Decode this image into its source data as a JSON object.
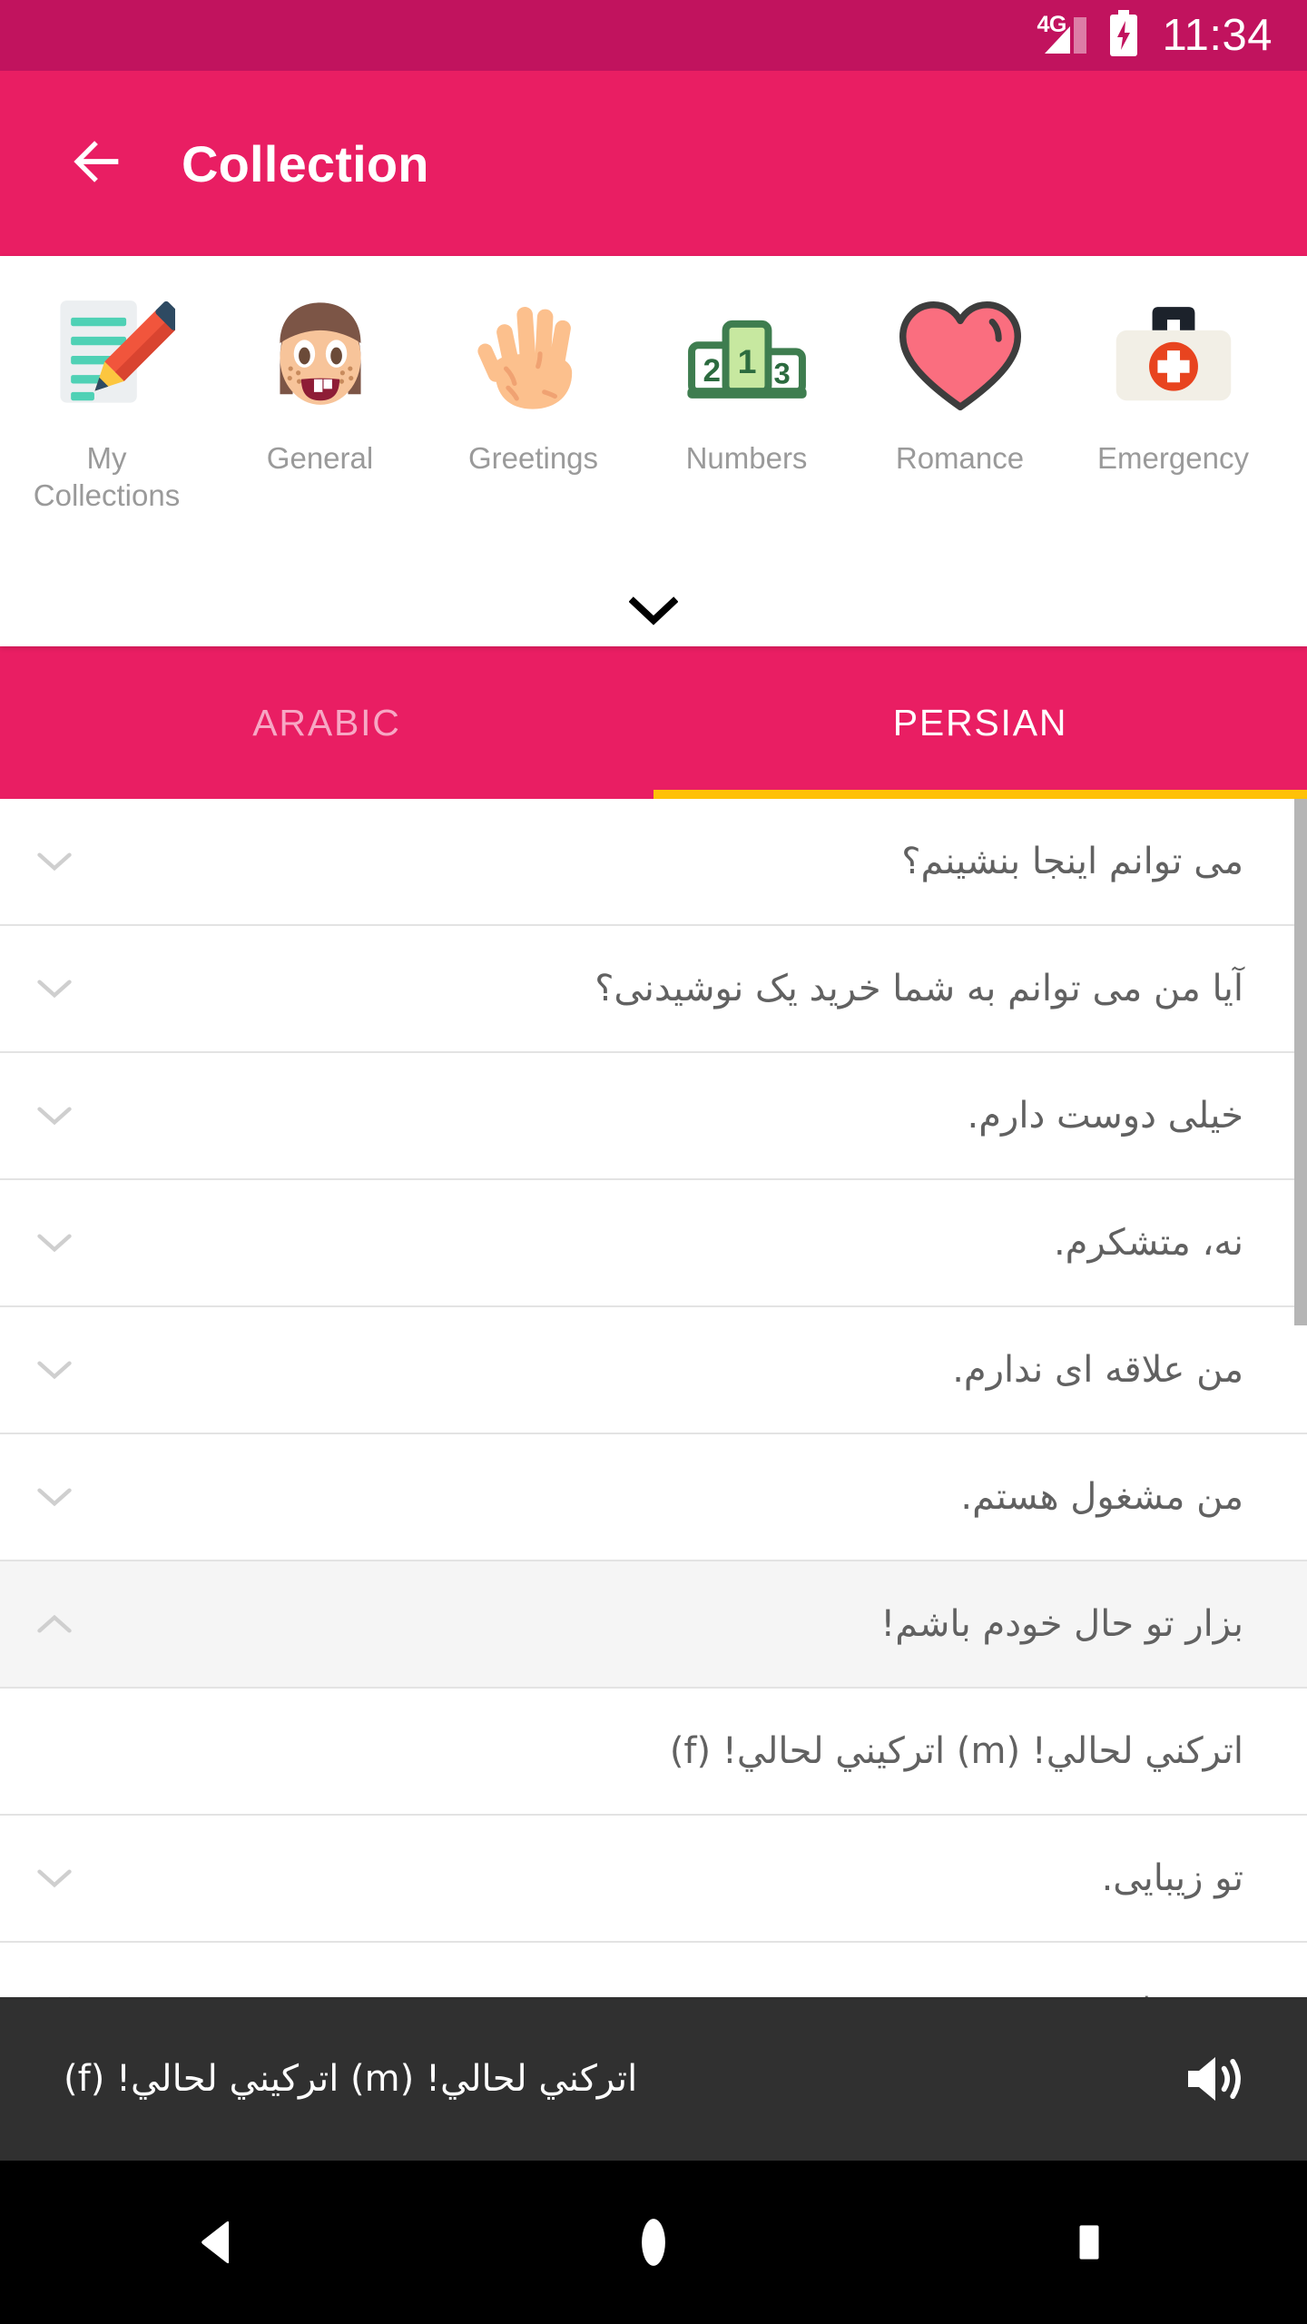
{
  "status_bar": {
    "network": "4G",
    "network_icon": "signal-bars-icon",
    "battery_icon": "battery-charging-icon",
    "time": "11:34",
    "background": "#c1135e"
  },
  "app_bar": {
    "back_icon": "back-arrow-icon",
    "title": "Collection",
    "background": "#e91e63"
  },
  "categories": {
    "expand_icon": "chevron-down-icon",
    "items": [
      {
        "label": "My Collections",
        "icon": "memo-pencil-icon"
      },
      {
        "label": "General",
        "icon": "girl-face-icon"
      },
      {
        "label": "Greetings",
        "icon": "raised-hand-icon"
      },
      {
        "label": "Numbers",
        "icon": "podium-123-icon"
      },
      {
        "label": "Romance",
        "icon": "heart-icon"
      },
      {
        "label": "Emergency",
        "icon": "first-aid-kit-icon"
      }
    ]
  },
  "tabs": {
    "indicator_color": "#ffc107",
    "items": [
      {
        "label": "ARABIC",
        "active": false
      },
      {
        "label": "PERSIAN",
        "active": true
      }
    ]
  },
  "list": {
    "chevron_down_icon": "chevron-down-icon",
    "chevron_up_icon": "chevron-up-icon",
    "rows": [
      {
        "text": "می توانم اینجا بنشینم؟",
        "expanded": false
      },
      {
        "text": "آیا من می توانم به شما خرید یک نوشیدنی؟",
        "expanded": false
      },
      {
        "text": "خیلی دوست دارم.",
        "expanded": false
      },
      {
        "text": "نه، متشکرم.",
        "expanded": false
      },
      {
        "text": "من علاقه ای ندارم.",
        "expanded": false
      },
      {
        "text": "من مشغول هستم.",
        "expanded": false
      },
      {
        "text": "بزار تو حال خودم باشم!",
        "expanded": true,
        "translation": "اتركني لحالي! (m)  اتركيني لحالي! (f)"
      },
      {
        "text": "تو زیبایی.",
        "expanded": false
      },
      {
        "text": "تو خوشتیپ هستی.",
        "expanded": false
      }
    ]
  },
  "player": {
    "text": "اتركني لحالي! (m)  اتركيني لحالي! (f)",
    "speaker_icon": "speaker-volume-icon",
    "background": "#303030"
  },
  "nav_bar": {
    "back_icon": "nav-back-triangle-icon",
    "home_icon": "nav-home-circle-icon",
    "recents_icon": "nav-recents-square-icon"
  }
}
